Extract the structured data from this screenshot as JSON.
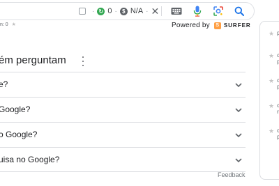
{
  "toolbar": {
    "metric_1": "0",
    "metric_2": "N/A",
    "left_small_text": "n: 0",
    "powered_label": "Powered by",
    "surfer_name": "SURFER"
  },
  "people_also_ask": {
    "title": "ém perguntam",
    "questions": [
      "e?",
      "Google?",
      "o Google?",
      "uisa no Google?"
    ],
    "feedback": "Feedback"
  },
  "side_panel": {
    "items": [
      "p",
      "c\np",
      "c\np",
      "c\nr",
      "c\np"
    ]
  },
  "colors": {
    "accent_blue": "#1a73e8",
    "surfer_orange": "#ff9f43",
    "green_icon": "#34a853"
  }
}
